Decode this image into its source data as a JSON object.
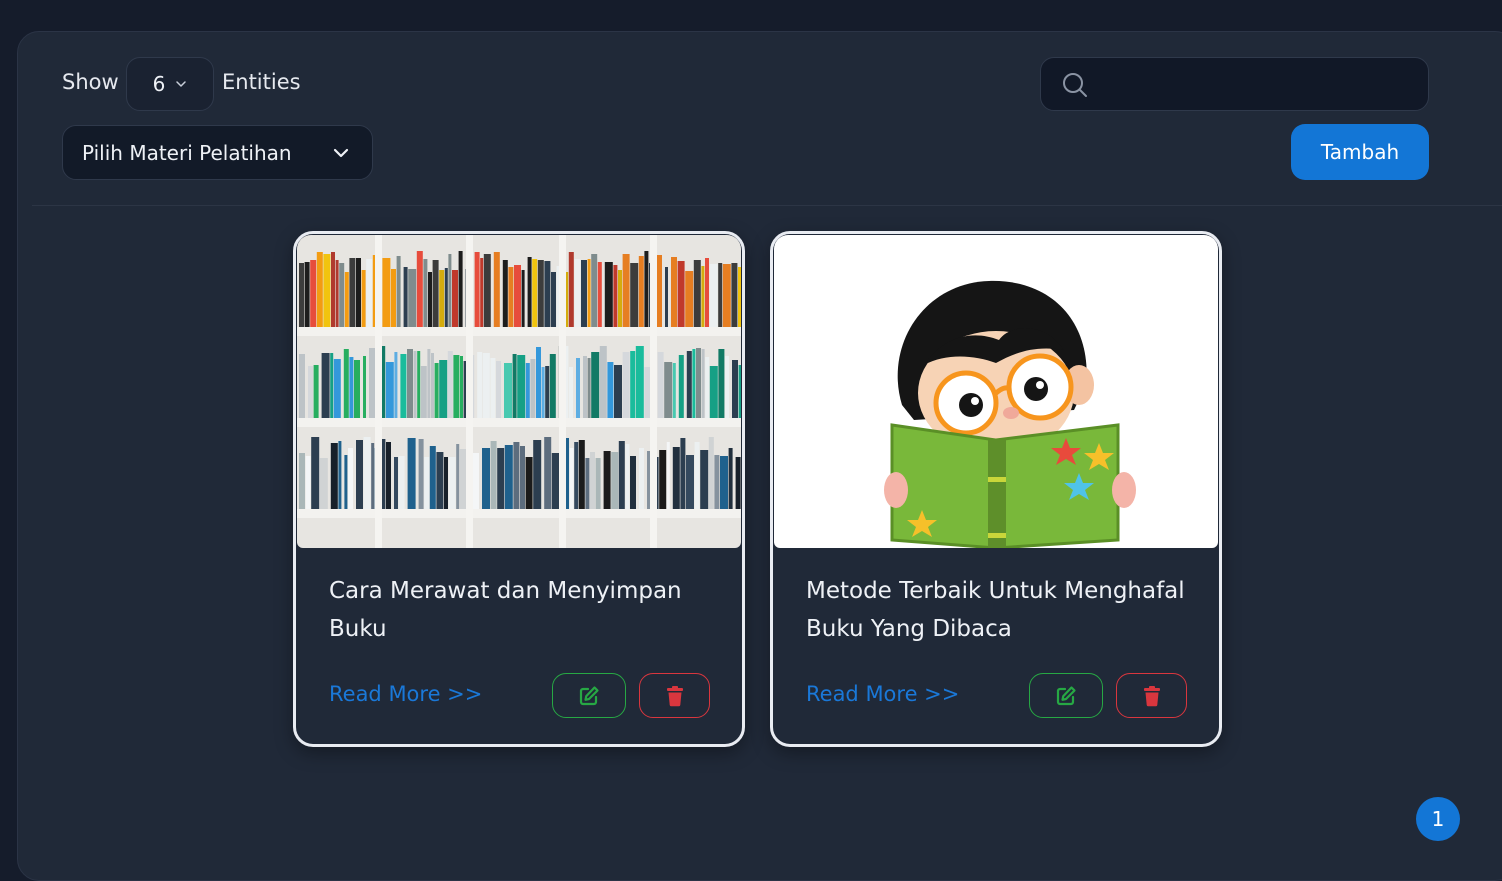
{
  "toolbar": {
    "show_label": "Show",
    "entries_value": "6",
    "entities_label": "Entities",
    "search": {
      "value": "",
      "placeholder": ""
    },
    "materi_select": {
      "value": "Pilih Materi Pelatihan"
    },
    "add_button_label": "Tambah"
  },
  "cards": [
    {
      "title": "Cara Merawat dan Menyimpan Buku",
      "image": "bookshelf-photo",
      "read_more": "Read More >>",
      "edit_icon": "edit-icon",
      "delete_icon": "trash-icon"
    },
    {
      "title": "Metode Terbaik Untuk Menghafal Buku Yang Dibaca",
      "image": "child-reading-book-illustration",
      "read_more": "Read More >>",
      "edit_icon": "edit-icon",
      "delete_icon": "trash-icon"
    }
  ],
  "pagination": {
    "current_page": "1"
  },
  "colors": {
    "background": "#151c2b",
    "panel": "#202938",
    "primary": "#1376d6",
    "edit": "#27a844",
    "delete": "#d9363e",
    "link": "#1a78d8"
  }
}
